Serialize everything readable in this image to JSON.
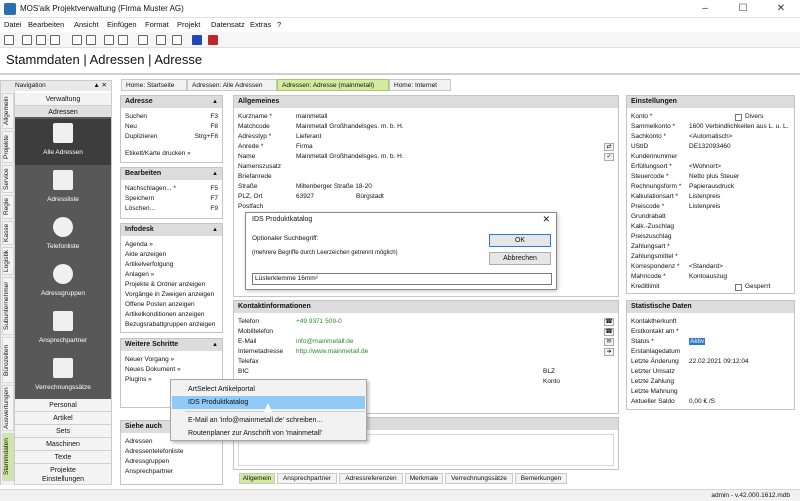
{
  "window": {
    "title": "MOS'aik Projektverwaltung (Firma Muster AG)"
  },
  "menu": [
    "Datei",
    "Bearbeiten",
    "Ansicht",
    "Einfügen",
    "Format",
    "Projekt",
    "Datensatz",
    "Extras",
    "?"
  ],
  "page_title": "Stammdaten | Adressen | Adresse",
  "navigation": {
    "title": "Navigation",
    "vtabs": [
      "Allgemein",
      "Projekte",
      "Service",
      "Regie",
      "Kasse",
      "Logistik",
      "Subunternehmer",
      "Bürozeiten",
      "Auswertungen",
      "Stammdaten"
    ],
    "top_items": [
      "Verwaltung",
      "Adressen"
    ],
    "tiles": [
      "Alle Adressen",
      "Adressliste",
      "Telefonliste",
      "Adressgruppen",
      "Ansprechpartner",
      "Verrechnungssätze"
    ],
    "bottom_items": [
      "Personal",
      "Artikel",
      "Sets",
      "Maschinen",
      "Texte",
      "Projekte",
      "Einstellungen"
    ]
  },
  "tabs": [
    "Home: Startseite",
    "Adressen: Alle Adressen",
    "Adressen: Adresse (mainmetall)",
    "Home: Internet"
  ],
  "side": {
    "adresse": {
      "title": "Adresse",
      "items": [
        [
          "Suchen",
          "F3"
        ],
        [
          "Neu",
          "F8"
        ],
        [
          "Duplizieren",
          "Strg+F8"
        ]
      ],
      "extra": "Etikett/Karte drucken »"
    },
    "bearbeiten": {
      "title": "Bearbeiten",
      "items": [
        [
          "Nachschlagen... *",
          "F5"
        ],
        [
          "Speichern",
          "F7"
        ],
        [
          "Löschen...",
          "F9"
        ]
      ]
    },
    "infodesk": {
      "title": "Infodesk",
      "items": [
        "Agenda »",
        "Akte anzeigen",
        "Artikelverfolgung",
        "Anlagen »",
        "Projekte & Ordner anzeigen",
        "Vorgänge in Zweigen anzeigen",
        "Offene Posten anzeigen",
        "Artikelkonditionen anzeigen",
        "Bezugsrabattgruppen anzeigen"
      ]
    },
    "weitere": {
      "title": "Weitere Schritte",
      "items": [
        "Neuer Vorgang »",
        "Neues Dokument »",
        "Plugins »"
      ]
    },
    "siehe": {
      "title": "Siehe auch",
      "items": [
        "Adressen",
        "Adressentelefonliste",
        "Adressgruppen",
        "Ansprechpartner"
      ]
    }
  },
  "allgemeines": {
    "title": "Allgemeines",
    "fields": [
      [
        "Kurzname *",
        "mainmetall"
      ],
      [
        "Matchcode",
        "Mainmetall Großhandelsges. m. b. H."
      ],
      [
        "Adresstyp *",
        "Lieferant"
      ],
      [
        "Anrede *",
        "Firma"
      ],
      [
        "Name",
        "Mainmetall Großhandelsges. m. b. H."
      ],
      [
        "Namenszusatz",
        ""
      ],
      [
        "Briefanrede",
        ""
      ],
      [
        "Straße",
        "Miltenberger Straße 18-20"
      ],
      [
        "PLZ, Ort",
        "63927"
      ],
      [
        "Postfach",
        ""
      ]
    ],
    "ort": "Bürgstadt"
  },
  "kontakt": {
    "title": "Kontaktinformationen",
    "fields": [
      [
        "Telefon",
        "+49 9371 509-0"
      ],
      [
        "Mobiltelefon",
        ""
      ],
      [
        "E-Mail",
        "info@mainmetall.de"
      ],
      [
        "Internetadresse",
        "http://www.mainmetall.de"
      ],
      [
        "Telefax",
        ""
      ],
      [
        "BIC",
        ""
      ]
    ],
    "blz": "BLZ",
    "konto": "Konto"
  },
  "einstellungen": {
    "title": "Einstellungen",
    "fields": [
      [
        "Konto *",
        ""
      ],
      [
        "Sammelkonto *",
        "1600 Verbindlichkeiten aus L. u. L."
      ],
      [
        "Sachkonto *",
        "<Automatisch>"
      ],
      [
        "UStID",
        "DE132093460"
      ],
      [
        "Kundennummer",
        ""
      ],
      [
        "Erfüllungsort *",
        "<Wohnort>"
      ],
      [
        "Steuercode *",
        "Netto plus Steuer"
      ],
      [
        "Rechnungsform *",
        "Papierausdruck"
      ],
      [
        "Kalkulationsart *",
        "Listenpreis"
      ],
      [
        "Preiscode *",
        "Listenpreis"
      ],
      [
        "Grundrabatt",
        ""
      ],
      [
        "Kalk.-Zuschlag",
        ""
      ],
      [
        "Preiszuschlag",
        ""
      ],
      [
        "Zahlungsart *",
        ""
      ],
      [
        "Zahlungsmittel *",
        ""
      ],
      [
        "Korrespondenz *",
        "<Standard>"
      ],
      [
        "Mahncode *",
        "Kontoauszug"
      ],
      [
        "Kreditlimit",
        ""
      ]
    ],
    "divers": "Divers",
    "gesperrt": "Gesperrt"
  },
  "statistik": {
    "title": "Statistische Daten",
    "fields": [
      [
        "Kontaktherkunft",
        ""
      ],
      [
        "Erstkontakt am *",
        ""
      ],
      [
        "Status *",
        "Aktiv"
      ],
      [
        "Erstanlagedatum",
        ""
      ],
      [
        "Letzte Änderung",
        "22.02.2021 09:12:04"
      ],
      [
        "Letzter Umsatz",
        ""
      ],
      [
        "Letzte Zahlung",
        ""
      ],
      [
        "Letzte Mahnung",
        ""
      ],
      [
        "Aktueller Saldo",
        "0,00 € /S"
      ]
    ]
  },
  "bottom_tabs": [
    "Allgemein",
    "Ansprechpartner",
    "Adressreferenzen",
    "Merkmale",
    "Verrechnungssätze",
    "Bemerkungen"
  ],
  "status_bar": "admin - v.42.000.1612.mdb",
  "dialog": {
    "title": "IDS Produktkatalog",
    "label": "Optionaler Suchbegriff:",
    "hint": "(mehrere Begriffe durch Leerzeichen getrennt möglich)",
    "value": "Lüsterklemme 16mm²",
    "ok": "OK",
    "cancel": "Abbrechen"
  },
  "context_menu": [
    "ArtSelect Artikelportal",
    "IDS Produktkatalog",
    "E-Mail an 'info@mainmetall.de' schreiben...",
    "Routenplaner zur Anschrift von 'mainmetall'"
  ]
}
